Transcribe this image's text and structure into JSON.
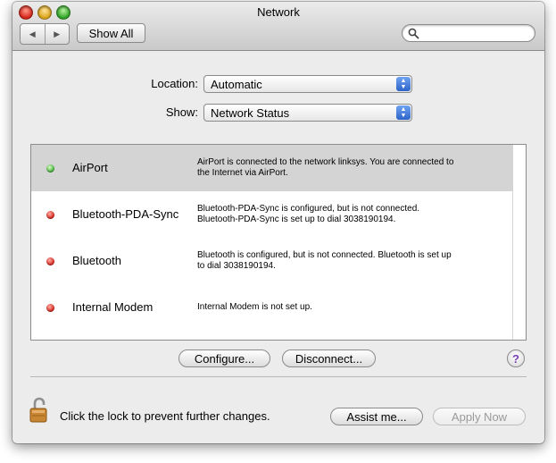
{
  "window": {
    "title": "Network"
  },
  "toolbar": {
    "back_glyph": "◀",
    "forward_glyph": "▶",
    "show_all_label": "Show All",
    "search_placeholder": "",
    "search_value": ""
  },
  "location": {
    "label": "Location:",
    "value": "Automatic"
  },
  "show": {
    "label": "Show:",
    "value": "Network Status"
  },
  "services": [
    {
      "name": "AirPort",
      "status_color": "green",
      "status_line1": "AirPort is connected to the network linksys. You are connected to",
      "status_line2": "the Internet via AirPort.",
      "selected": true
    },
    {
      "name": "Bluetooth-PDA-Sync",
      "status_color": "red",
      "status_line1": "Bluetooth-PDA-Sync is configured, but is not connected.",
      "status_line2": "Bluetooth-PDA-Sync is set up to dial 3038190194.",
      "selected": false
    },
    {
      "name": "Bluetooth",
      "status_color": "red",
      "status_line1": "Bluetooth is configured, but is not connected. Bluetooth is set up",
      "status_line2": "to dial 3038190194.",
      "selected": false
    },
    {
      "name": "Internal Modem",
      "status_color": "red",
      "status_line1": "Internal Modem is not set up.",
      "status_line2": "",
      "selected": false
    }
  ],
  "actions": {
    "configure_label": "Configure...",
    "disconnect_label": "Disconnect...",
    "help_glyph": "?"
  },
  "footer": {
    "lock_text": "Click the lock to prevent further changes.",
    "assist_label": "Assist me...",
    "apply_label": "Apply Now",
    "apply_enabled": false
  },
  "colors": {
    "status_green": "#3ca830",
    "status_red": "#d01b12",
    "selection": "#d4d4d4",
    "help_accent": "#7a3fb5"
  }
}
